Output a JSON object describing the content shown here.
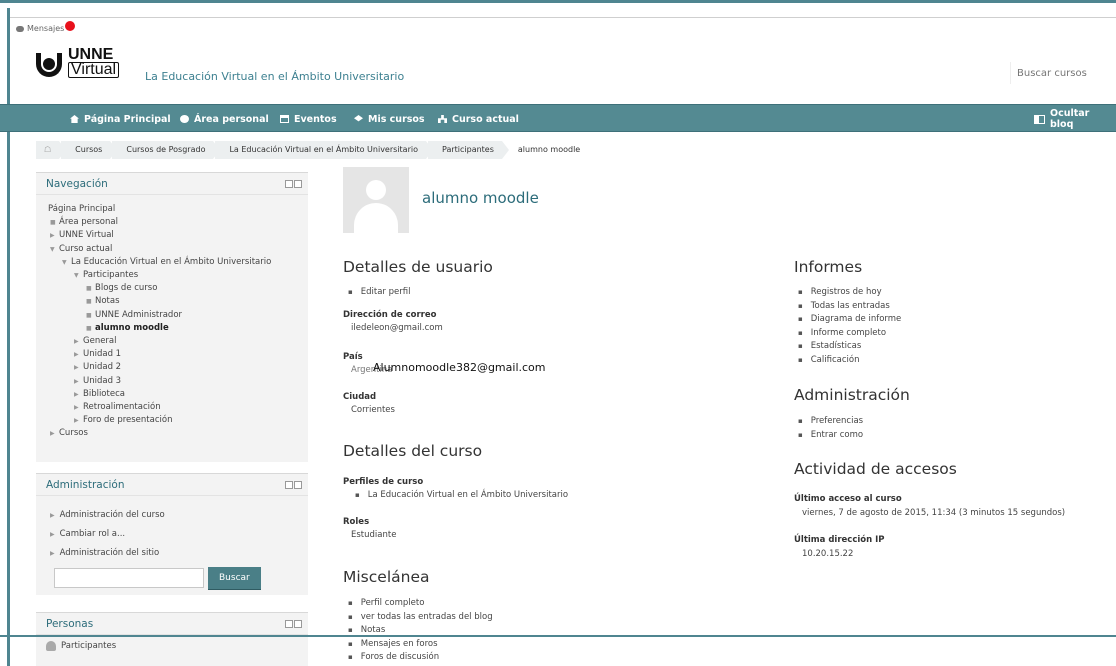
{
  "header": {
    "messages_label": "Mensajes",
    "logo": {
      "line1": "UNNE",
      "line2": "Virtual"
    },
    "slogan": "La Educación Virtual en el Ámbito Universitario",
    "search_placeholder": "Buscar cursos"
  },
  "navbar": {
    "items": [
      {
        "icon": "home-icon",
        "label": "Página Principal"
      },
      {
        "icon": "dashboard-icon",
        "label": "Área personal"
      },
      {
        "icon": "calendar-icon",
        "label": "Eventos"
      },
      {
        "icon": "graduation-cap-icon",
        "label": "Mis cursos"
      },
      {
        "icon": "sitemap-icon",
        "label": "Curso actual"
      }
    ],
    "hide_blocks": "Ocultar bloq"
  },
  "breadcrumb": [
    "Cursos",
    "Cursos de Posgrado",
    "La Educación Virtual en el Ámbito Universitario",
    "Participantes",
    "alumno moodle"
  ],
  "navigation": {
    "title": "Navegación",
    "tree": [
      {
        "label": "Página Principal"
      },
      {
        "label": "Área personal"
      },
      {
        "label": "UNNE Virtual"
      },
      {
        "label": "Curso actual"
      },
      {
        "label": "La Educación Virtual en el Ámbito Universitario"
      },
      {
        "label": "Participantes"
      },
      {
        "label": "Blogs de curso"
      },
      {
        "label": "Notas"
      },
      {
        "label": "UNNE Administrador"
      },
      {
        "label": "alumno moodle"
      },
      {
        "label": "General"
      },
      {
        "label": "Unidad 1"
      },
      {
        "label": "Unidad 2"
      },
      {
        "label": "Unidad 3"
      },
      {
        "label": "Biblioteca"
      },
      {
        "label": "Retroalimentación"
      },
      {
        "label": "Foro de presentación"
      },
      {
        "label": "Cursos"
      }
    ]
  },
  "administration_block": {
    "title": "Administración",
    "items": [
      "Administración del curso",
      "Cambiar rol a...",
      "Administración del sitio"
    ],
    "search_button": "Buscar"
  },
  "people_block": {
    "title": "Personas",
    "items": [
      "Participantes"
    ]
  },
  "profile": {
    "name": "alumno moodle",
    "user_details": {
      "title": "Detalles de usuario",
      "edit_link": "Editar perfil",
      "email_label": "Dirección de correo",
      "email": "iledeleon@gmail.com",
      "country_label": "País",
      "country": "Argentina",
      "city_label": "Ciudad",
      "city": "Corrientes"
    },
    "course_details": {
      "title": "Detalles del curso",
      "profiles_label": "Perfiles de curso",
      "profiles": [
        "La Educación Virtual en el Ámbito Universitario"
      ],
      "roles_label": "Roles",
      "role": "Estudiante"
    },
    "misc": {
      "title": "Miscelánea",
      "items": [
        "Perfil completo",
        "ver todas las entradas del blog",
        "Notas",
        "Mensajes en foros",
        "Foros de discusión"
      ]
    },
    "reports": {
      "title": "Informes",
      "items": [
        "Registros de hoy",
        "Todas las entradas",
        "Diagrama de informe",
        "Informe completo",
        "Estadísticas",
        "Calificación"
      ]
    },
    "admin": {
      "title": "Administración",
      "items": [
        "Preferencias",
        "Entrar como"
      ]
    },
    "access": {
      "title": "Actividad de accesos",
      "last_course_label": "Último acceso al curso",
      "last_course": "viernes, 7 de agosto de 2015, 11:34  (3 minutos 15 segundos)",
      "last_ip_label": "Última dirección IP",
      "last_ip": "10.20.15.22"
    }
  },
  "overlay_text": "Alumnomoodle382@gmail.com"
}
